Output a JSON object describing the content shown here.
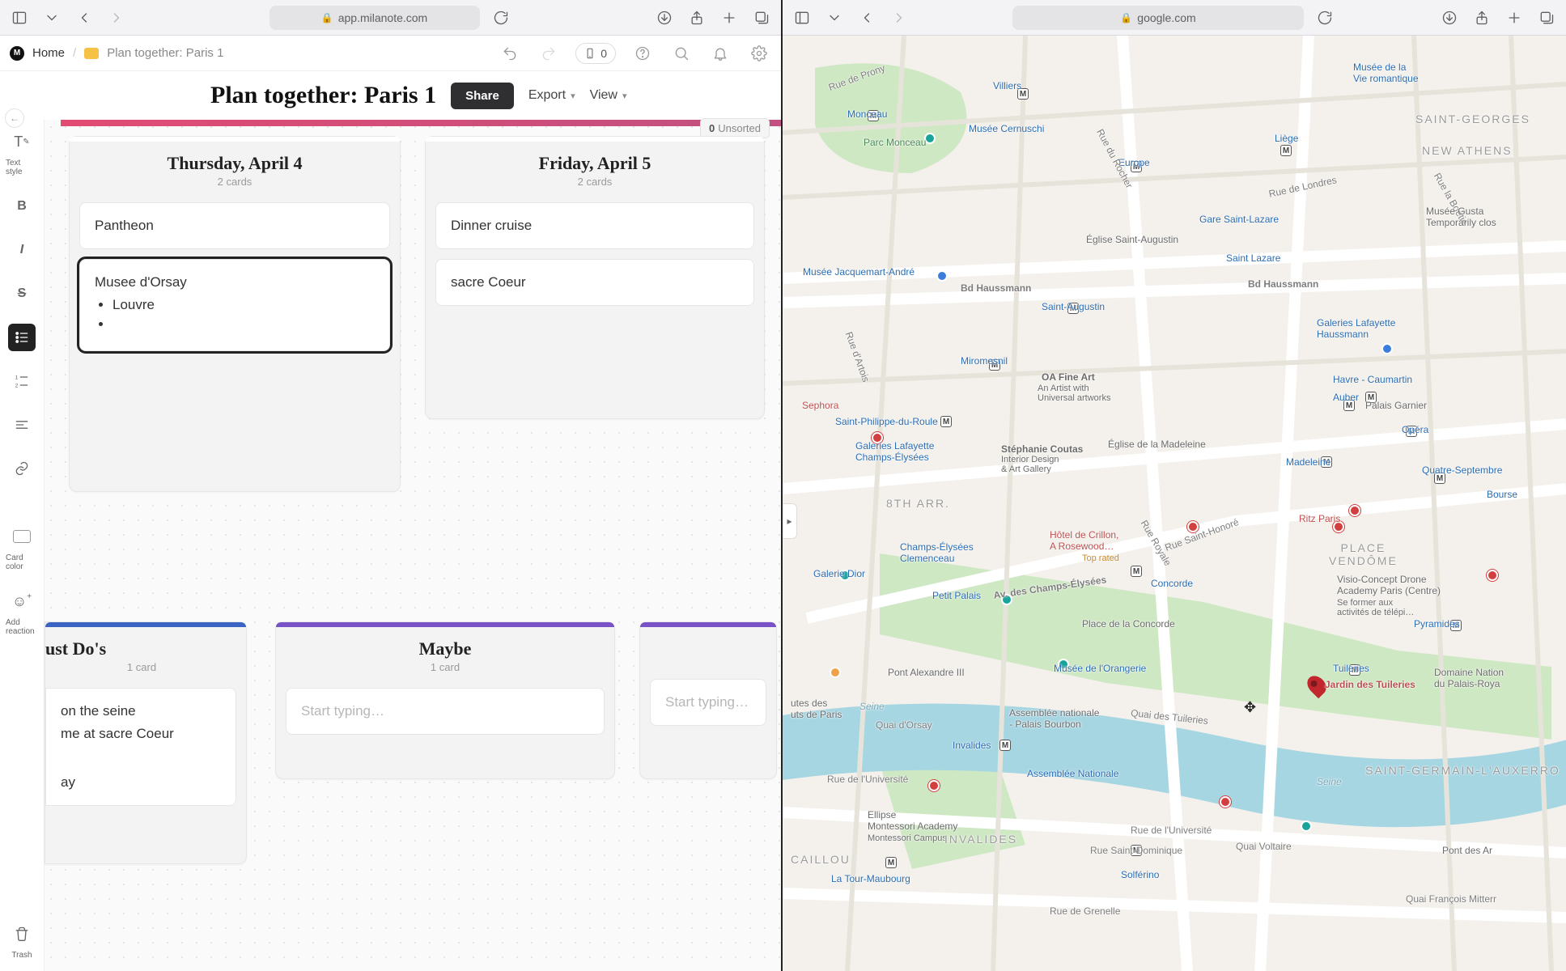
{
  "left": {
    "url_host": "app.milanote.com",
    "breadcrumb": {
      "home": "Home",
      "current": "Plan together: Paris 1"
    },
    "phone_pill_count": "0",
    "board_title": "Plan together: Paris 1",
    "share_label": "Share",
    "export_label": "Export",
    "view_label": "View",
    "unsorted": {
      "count": "0",
      "label": "Unsorted"
    },
    "rail": {
      "text_style": "Text style",
      "card_color": "Card color",
      "add_reaction": "Add reaction",
      "trash": "Trash"
    },
    "columns": {
      "thursday": {
        "title": "Thursday, April 4",
        "sub": "2 cards",
        "card1": "Pantheon",
        "card2_title": "Musee d'Orsay",
        "card2_bullets": [
          "Louvre",
          ""
        ]
      },
      "friday": {
        "title": "Friday, April 5",
        "sub": "2 cards",
        "card1": "Dinner cruise",
        "card2": "sacre Coeur"
      },
      "mustdos": {
        "title": "ust Do's",
        "sub": "1 card",
        "line1": "on the seine",
        "line2": "me at sacre Coeur",
        "line3": "ay"
      },
      "maybe": {
        "title": "Maybe",
        "sub": "1 card",
        "placeholder": "Start typing…"
      },
      "third": {
        "placeholder": "Start typing…"
      }
    }
  },
  "right": {
    "url_host": "google.com",
    "labels": {
      "villiers": "Villiers",
      "monceau": "Monceau",
      "parc_monceau": "Parc Monceau",
      "cernuschi": "Musée Cernuschi",
      "romantique": "Musée de la\nVie romantique",
      "europe": "Europe",
      "saint_georges": "SAINT-GEORGES",
      "new_athens": "NEW ATHENS",
      "liege": "Liège",
      "gare_sl": "Gare Saint-Lazare",
      "st_lazare": "Saint Lazare",
      "st_augustin_church": "Église Saint-Augustin",
      "st_augustin": "Saint-Augustin",
      "jacquemart": "Musée Jacquemart-André",
      "haussmann": "Bd Haussmann",
      "haussmann2": "Bd Haussmann",
      "gl_haussmann": "Galeries Lafayette\nHaussmann",
      "miromesnil": "Miromesnil",
      "oa_fine": "OA Fine Art",
      "oa_sub": "An Artist with\nUniversal artworks",
      "havre": "Havre - Caumartin",
      "auber": "Auber",
      "sephora": "Sephora",
      "sp_roule": "Saint-Philippe-du-Roule",
      "gl_ce": "Galeries Lafayette\nChamps-Élysées",
      "coutas": "Stéphanie Coutas",
      "coutas_sub": "Interior Design\n& Art Gallery",
      "madeleine_church": "Église de la Madeleine",
      "madeleine": "Madeleine",
      "opera": "Opéra",
      "palais_garnier": "Palais Garnier",
      "quatre_sept": "Quatre-Septembre",
      "arr8": "8TH ARR.",
      "ce_clem": "Champs-Élysées\nClemenceau",
      "crillon": "Hôtel de Crillon,\nA Rosewood…",
      "crillon_sub": "Top rated",
      "ritz": "Ritz Paris",
      "vendome": "PLACE\nVENDÔME",
      "galerie_dior": "Galerie Dior",
      "petit_palais": "Petit Palais",
      "av_ce": "Av. des Champs-Élysées",
      "concorde": "Concorde",
      "p_concorde": "Place de la Concorde",
      "visio": "Visio-Concept Drone\nAcademy Paris (Centre)",
      "visio_sub": "Se former aux\nactivités de télépi…",
      "pyramides": "Pyramides",
      "tuileries_m": "Tuileries",
      "jardin": "Jardin des Tuileries",
      "domaine": "Domaine Nation\ndu Palais-Roya",
      "orangerie": "Musée de l'Orangerie",
      "pont_alex": "Pont Alexandre III",
      "seine": "Seine",
      "seine2": "Seine",
      "quai_orsay": "Quai d'Orsay",
      "quai_tuileries": "Quai des Tuileries",
      "utes": "utes des\nuts de Paris",
      "assemblee": "Assemblée nationale\n- Palais Bourbon",
      "assemblee2": "Assemblée Nationale",
      "invalides_m": "Invalides",
      "r_univ": "Rue de l'Université",
      "r_univ2": "Rue de l'Université",
      "st_germain": "SAINT-GERMAIN-L'AUXERRO",
      "ellipse": "Ellipse\nMontessori Academy",
      "ellipse_sub": "Montessori Campus",
      "invalides": "INVALIDES",
      "r_st_dom": "Rue Saint-Dominique",
      "r_voltaire": "Quai Voltaire",
      "pont_arts": "Pont des Ar",
      "caillou": "CAILLOU",
      "tour_maubourg": "La Tour-Maubourg",
      "solferino": "Solférino",
      "r_grenelle": "Rue de Grenelle",
      "quai_fr": "Quai François Mitterr",
      "r_prony": "Rue de Prony",
      "r_londres": "Rue de Londres",
      "r_rocher": "Rue du Rocher",
      "r_artois": "Rue d'Artois",
      "r_st_honore": "Rue Saint-Honoré",
      "r_royale": "Rue Royale",
      "r_boetie": "Rue la Boétie",
      "gustave": "Musée Gusta\nTemporarily clos",
      "bourse": "Bourse"
    }
  }
}
